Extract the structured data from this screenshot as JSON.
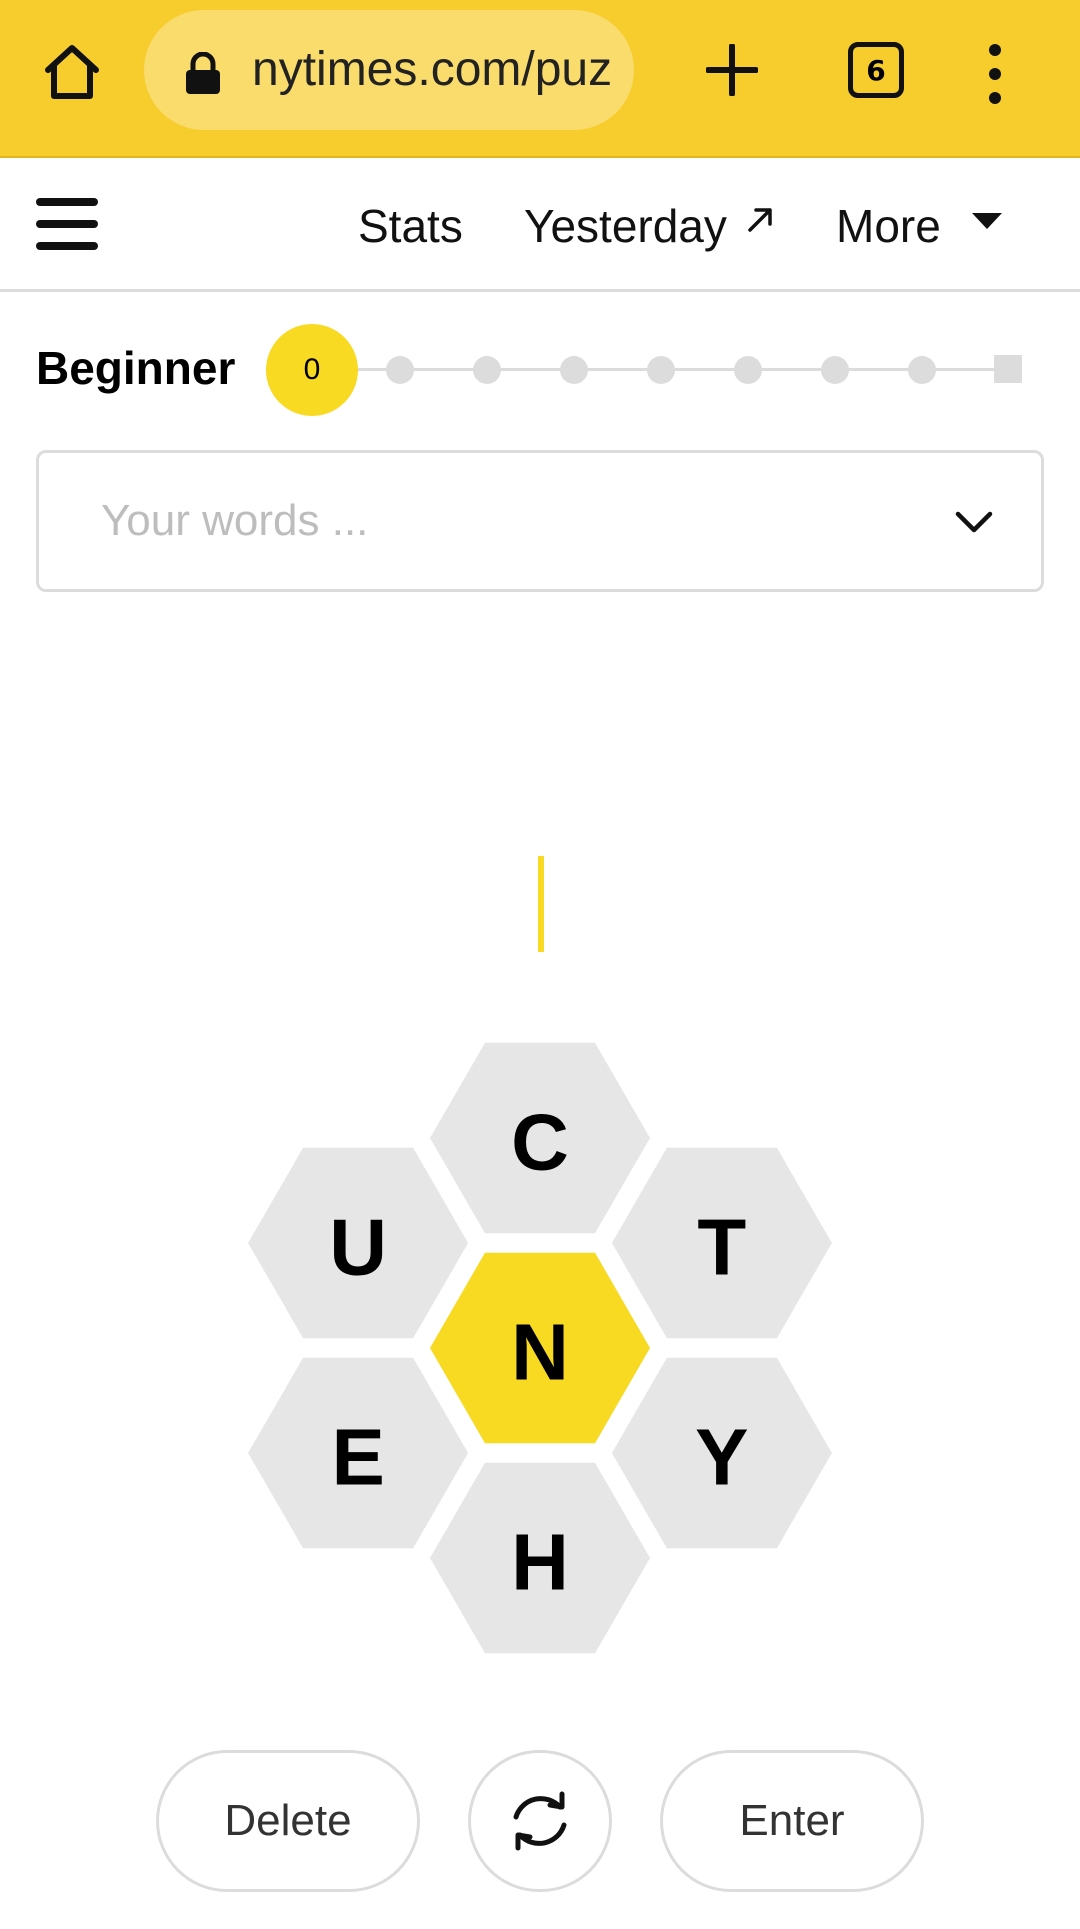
{
  "browser": {
    "url": "nytimes.com/puzzles/spelling-bee",
    "tab_count": "6"
  },
  "nav": {
    "stats_label": "Stats",
    "yesterday_label": "Yesterday",
    "more_label": "More"
  },
  "progress": {
    "rank": "Beginner",
    "score": "0"
  },
  "words": {
    "placeholder": "Your words ..."
  },
  "hive": {
    "center_letter": "N",
    "outer_letters": [
      "C",
      "T",
      "Y",
      "H",
      "E",
      "U"
    ]
  },
  "actions": {
    "delete_label": "Delete",
    "enter_label": "Enter"
  },
  "colors": {
    "browser_bar": "#f7cd2e",
    "center_hex": "#f7da21",
    "outer_hex": "#e6e6e6"
  }
}
